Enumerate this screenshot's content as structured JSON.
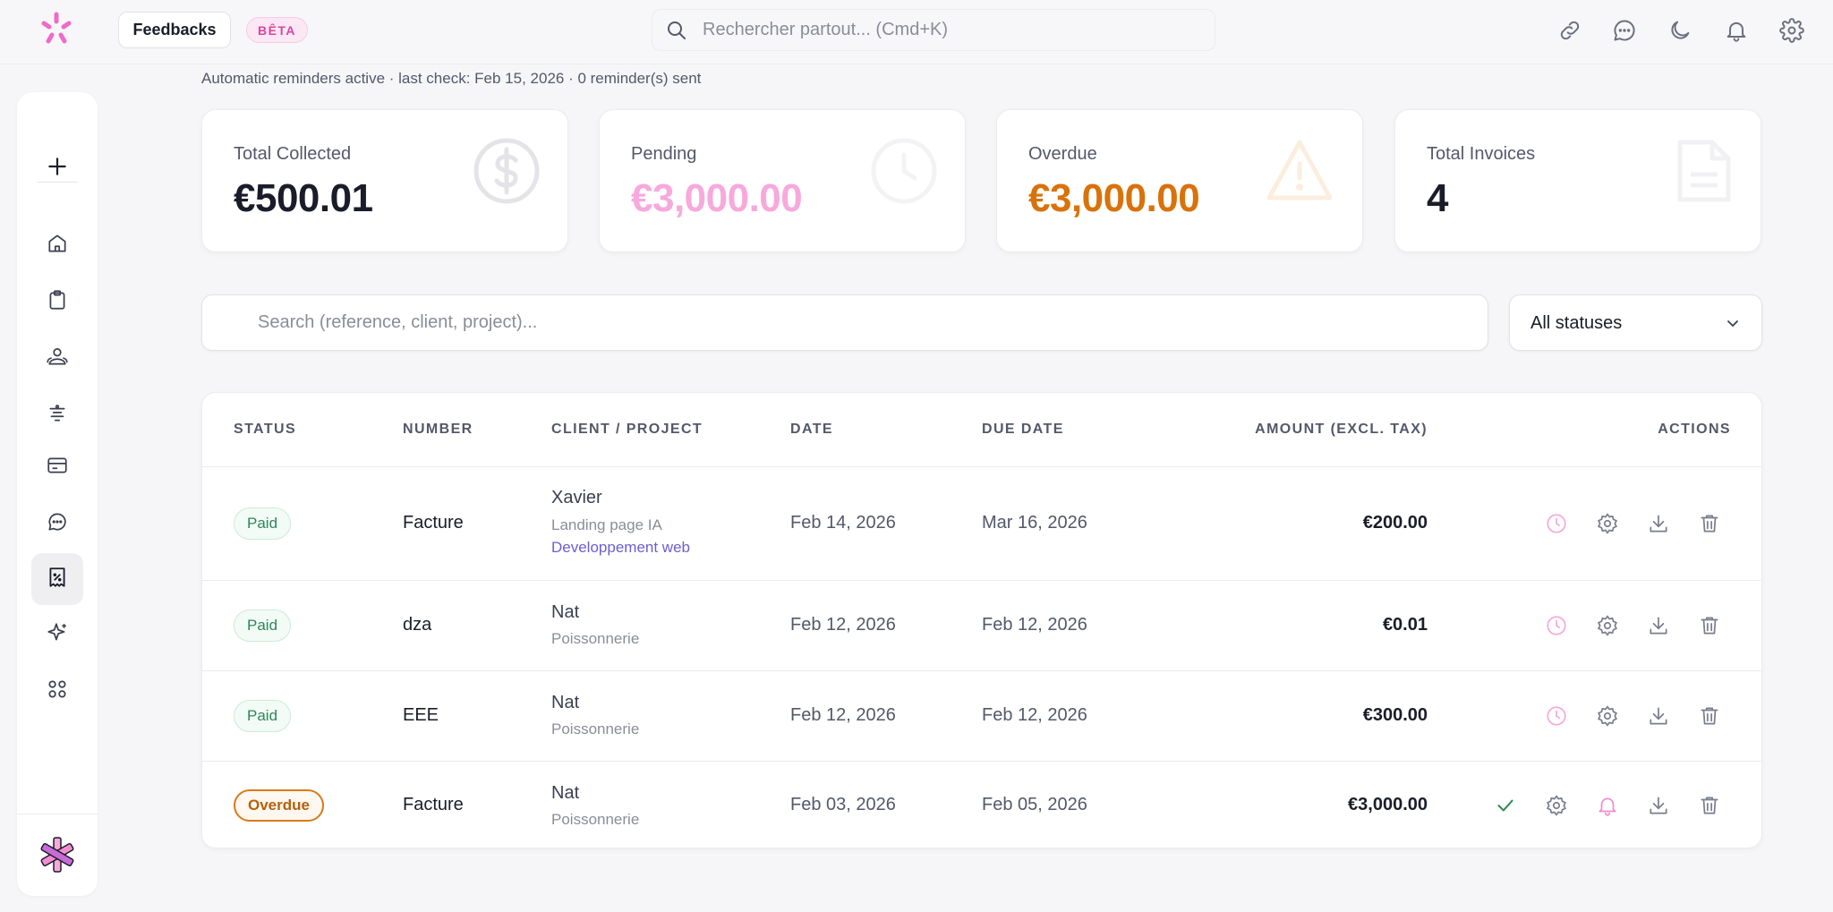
{
  "header": {
    "feedback_label": "Feedbacks",
    "beta_label": "BÊTA",
    "search_placeholder": "Rechercher partout... (Cmd+K)",
    "icons": [
      "link-icon",
      "chat-icon",
      "moon-icon",
      "bell-icon",
      "gear-icon"
    ]
  },
  "sidebar": {
    "items": [
      {
        "name": "plus-icon"
      },
      {
        "name": "home-icon"
      },
      {
        "name": "clipboard-icon"
      },
      {
        "name": "users-icon"
      },
      {
        "name": "filter-stack-icon"
      },
      {
        "name": "card-icon"
      },
      {
        "name": "chat-icon"
      },
      {
        "name": "invoice-icon",
        "active": true
      },
      {
        "name": "sparkle-icon"
      },
      {
        "name": "apps-grid-icon"
      }
    ]
  },
  "reminder_status": "Automatic reminders active · last check: Feb 15, 2026 · 0 reminder(s) sent",
  "stats": [
    {
      "label": "Total Collected",
      "value": "€500.01",
      "color": "#1a1d29",
      "icon": "dollar-icon"
    },
    {
      "label": "Pending",
      "value": "€3,000.00",
      "color": "#f7a9dc",
      "icon": "clock-icon"
    },
    {
      "label": "Overdue",
      "value": "€3,000.00",
      "color": "#d9720b",
      "icon": "warning-icon"
    },
    {
      "label": "Total Invoices",
      "value": "4",
      "color": "#1a1d29",
      "icon": "document-icon"
    }
  ],
  "filters": {
    "search_placeholder": "Search (reference, client, project)...",
    "status_value": "All statuses"
  },
  "table": {
    "columns": [
      "STATUS",
      "NUMBER",
      "CLIENT / PROJECT",
      "DATE",
      "DUE DATE",
      "AMOUNT (EXCL. TAX)",
      "ACTIONS"
    ],
    "rows": [
      {
        "status": "Paid",
        "status_kind": "paid",
        "number": "Facture",
        "client": "Xavier",
        "project": "Landing page IA",
        "category": "Developpement web",
        "date": "Feb 14, 2026",
        "due_date": "Mar 16, 2026",
        "amount": "€200.00"
      },
      {
        "status": "Paid",
        "status_kind": "paid",
        "number": "dza",
        "client": "Nat",
        "project": "Poissonnerie",
        "category": "",
        "date": "Feb 12, 2026",
        "due_date": "Feb 12, 2026",
        "amount": "€0.01"
      },
      {
        "status": "Paid",
        "status_kind": "paid",
        "number": "EEE",
        "client": "Nat",
        "project": "Poissonnerie",
        "category": "",
        "date": "Feb 12, 2026",
        "due_date": "Feb 12, 2026",
        "amount": "€300.00"
      },
      {
        "status": "Overdue",
        "status_kind": "overdue",
        "number": "Facture",
        "client": "Nat",
        "project": "Poissonnerie",
        "category": "",
        "date": "Feb 03, 2026",
        "due_date": "Feb 05, 2026",
        "amount": "€3,000.00"
      }
    ]
  }
}
